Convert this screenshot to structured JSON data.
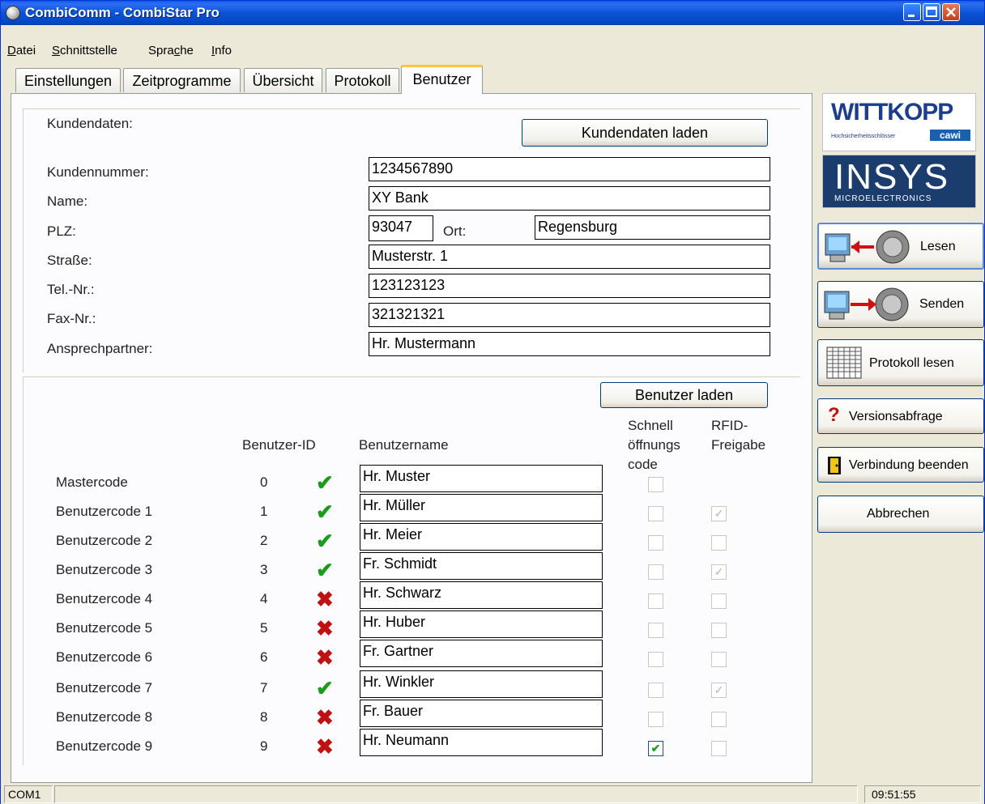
{
  "window": {
    "title": "CombiComm - CombiStar Pro"
  },
  "menu": {
    "items": [
      {
        "pre": "D",
        "rest": "atei"
      },
      {
        "pre": "S",
        "rest": "chnittstelle"
      },
      {
        "pre": "Spra",
        "mid": "c",
        "rest": "he"
      },
      {
        "pre": "I",
        "rest": "nfo"
      }
    ]
  },
  "tabs": [
    "Einstellungen",
    "Zeitprogramme",
    "Übersicht",
    "Protokoll",
    "Benutzer"
  ],
  "active_tab": "Benutzer",
  "customer": {
    "section_label": "Kundendaten:",
    "load_button": "Kundendaten laden",
    "labels": {
      "number": "Kundennummer:",
      "name": "Name:",
      "zip": "PLZ:",
      "city": "Ort:",
      "street": "Straße:",
      "phone": "Tel.-Nr.:",
      "fax": "Fax-Nr.:",
      "contact": "Ansprechpartner:"
    },
    "values": {
      "number": "1234567890",
      "name": "XY Bank",
      "zip": "93047",
      "city": "Regensburg",
      "street": "Musterstr. 1",
      "phone": "123123123",
      "fax": "321321321",
      "contact": "Hr. Mustermann"
    }
  },
  "users": {
    "load_button": "Benutzer laden",
    "headers": {
      "id": "Benutzer-ID",
      "name": "Benutzername",
      "quick_line1": "Schnell",
      "quick_line2": "öffnungs",
      "quick_line3": "code",
      "rfid_line1": "RFID-",
      "rfid_line2": "Freigabe"
    },
    "rows": [
      {
        "label": "Mastercode",
        "id": "0",
        "valid": true,
        "name": "Hr. Muster",
        "quick": false,
        "rfid": null
      },
      {
        "label": "Benutzercode 1",
        "id": "1",
        "valid": true,
        "name": "Hr. Müller",
        "quick": false,
        "rfid": true
      },
      {
        "label": "Benutzercode 2",
        "id": "2",
        "valid": true,
        "name": "Hr. Meier",
        "quick": false,
        "rfid": false
      },
      {
        "label": "Benutzercode 3",
        "id": "3",
        "valid": true,
        "name": "Fr. Schmidt",
        "quick": false,
        "rfid": true
      },
      {
        "label": "Benutzercode 4",
        "id": "4",
        "valid": false,
        "name": "Hr. Schwarz",
        "quick": false,
        "rfid": false
      },
      {
        "label": "Benutzercode 5",
        "id": "5",
        "valid": false,
        "name": "Hr. Huber",
        "quick": false,
        "rfid": false
      },
      {
        "label": "Benutzercode 6",
        "id": "6",
        "valid": false,
        "name": "Fr. Gartner",
        "quick": false,
        "rfid": false
      },
      {
        "label": "Benutzercode 7",
        "id": "7",
        "valid": true,
        "name": "Hr. Winkler",
        "quick": false,
        "rfid": true
      },
      {
        "label": "Benutzercode 8",
        "id": "8",
        "valid": false,
        "name": "Fr. Bauer",
        "quick": false,
        "rfid": false
      },
      {
        "label": "Benutzercode 9",
        "id": "9",
        "valid": false,
        "name": "Hr. Neumann",
        "quick": true,
        "rfid": false
      }
    ]
  },
  "sidebar": {
    "logo_wittkopp": "WITTKOPP",
    "logo_wittkopp_sub": "Hochsicherheitsschlösser",
    "logo_cawi": "cawi",
    "logo_insys": "INSYS",
    "logo_insys_sub": "MICROELECTRONICS",
    "buttons": {
      "read": "Lesen",
      "send": "Senden",
      "log": "Protokoll lesen",
      "version": "Versionsabfrage",
      "disconnect": "Verbindung beenden",
      "cancel": "Abbrechen"
    }
  },
  "status": {
    "port": "COM1",
    "time": "09:51:55"
  },
  "colors": {
    "titlebar": "#0a53d6",
    "valid": "#1d9b1d",
    "invalid": "#c11010",
    "tab_highlight": "#ffc83c"
  }
}
